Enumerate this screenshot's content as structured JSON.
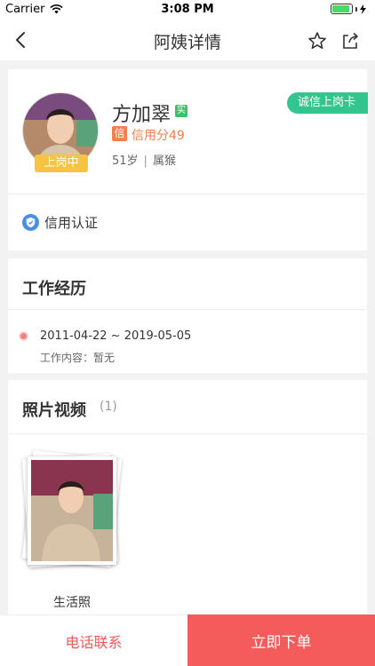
{
  "status_bar": {
    "carrier": "Carrier",
    "time": "3:08 PM",
    "battery_level": 0.9
  },
  "nav": {
    "title": "阿姨详情",
    "icons": [
      "back-icon",
      "star-icon",
      "share-icon"
    ]
  },
  "profile": {
    "name": "方加翠",
    "real_badge": "实",
    "credit_badge": "信",
    "credit_text": "信用分49",
    "age": "51岁",
    "zodiac": "属猴",
    "status_tag": "上岗中",
    "ribbon": "诚信上岗卡",
    "verify_label": "信用认证"
  },
  "work": {
    "title": "工作经历",
    "range": "2011-04-22 ~ 2019-05-05",
    "content": "工作内容：暂无"
  },
  "photos": {
    "title": "照片视频",
    "count": "(1)",
    "label": "生活照"
  },
  "actions": {
    "phone": "电话联系",
    "order": "立即下单"
  },
  "colors": {
    "accent_red": "#f45b5b",
    "ribbon_green": "#34c58e",
    "status_yellow": "#f6c343",
    "credit_orange": "#f08050"
  }
}
